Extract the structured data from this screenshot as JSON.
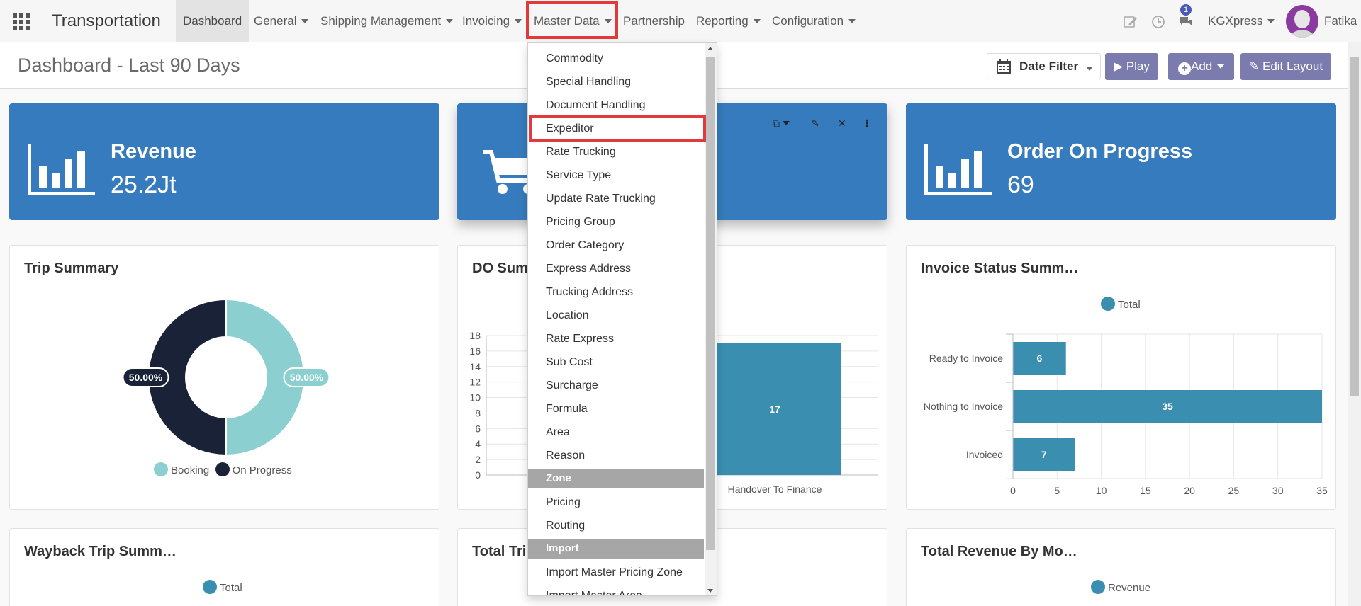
{
  "navbar": {
    "brand": "Transportation",
    "menus": [
      {
        "label": "Dashboard",
        "dropdown": false
      },
      {
        "label": "General",
        "dropdown": true
      },
      {
        "label": "Shipping Management",
        "dropdown": true
      },
      {
        "label": "Invoicing",
        "dropdown": true
      },
      {
        "label": "Master Data",
        "dropdown": true
      },
      {
        "label": "Partnership",
        "dropdown": false
      },
      {
        "label": "Reporting",
        "dropdown": true
      },
      {
        "label": "Configuration",
        "dropdown": true
      }
    ],
    "message_count": "1",
    "company": "KGXpress",
    "user": "Fatika"
  },
  "control": {
    "title": "Dashboard - Last 90 Days",
    "date_filter": "Date Filter",
    "play": "Play",
    "add": "Add",
    "edit_layout": "Edit Layout"
  },
  "kpis": [
    {
      "title": "Revenue",
      "value": "25.2Jt"
    },
    {
      "title": "",
      "value": ""
    },
    {
      "title": "Order On Progress",
      "value": "69"
    }
  ],
  "panels": {
    "trip_summary": "Trip Summary",
    "do_summary": "DO Sum",
    "invoice_status": "Invoice Status Summ…",
    "wayback": "Wayback Trip Summ…",
    "total_trip": "Total Trip",
    "total_revenue": "Total Revenue By Mo…"
  },
  "legends": {
    "invoice": "Total",
    "wayback": "Total",
    "revenue": "Revenue"
  },
  "colors": {
    "kpi": "#367bbd",
    "teal": "#3a8fb1",
    "booking": "#8ccfd0",
    "on_progress": "#1a2238",
    "highlight": "#e03a3a",
    "purple_button": "#7c7bad"
  },
  "chart_data": [
    {
      "type": "pie",
      "title": "Trip Summary",
      "categories": [
        "Booking",
        "On Progress"
      ],
      "values": [
        50.0,
        50.0
      ],
      "labels": [
        "50.00%",
        "50.00%"
      ],
      "donut": true,
      "legend": "bottom"
    },
    {
      "type": "bar",
      "title": "DO Sum",
      "categories": [
        "Handover To Finance"
      ],
      "values": [
        17
      ],
      "data_labels": [
        "17"
      ],
      "yticks": [
        "0",
        "2",
        "4",
        "6",
        "8",
        "10",
        "12",
        "14",
        "16",
        "18"
      ],
      "ylim": [
        0,
        18
      ],
      "grid": true
    },
    {
      "type": "bar",
      "orientation": "horizontal",
      "title": "Invoice Status Summ…",
      "categories": [
        "Ready to Invoice",
        "Nothing to Invoice",
        "Invoiced"
      ],
      "series": [
        {
          "name": "Total",
          "values": [
            6,
            35,
            7
          ]
        }
      ],
      "data_labels": [
        "6",
        "35",
        "7"
      ],
      "xticks": [
        "0",
        "5",
        "10",
        "15",
        "20",
        "25",
        "30",
        "35"
      ],
      "xlim": [
        0,
        35
      ],
      "legend": "top",
      "grid": true
    }
  ],
  "master_data_menu": {
    "items": [
      {
        "kind": "item",
        "label": "Commodity"
      },
      {
        "kind": "item",
        "label": "Special Handling"
      },
      {
        "kind": "item",
        "label": "Document Handling"
      },
      {
        "kind": "item",
        "label": "Expeditor",
        "highlighted": true
      },
      {
        "kind": "item",
        "label": "Rate Trucking"
      },
      {
        "kind": "item",
        "label": "Service Type"
      },
      {
        "kind": "item",
        "label": "Update Rate Trucking"
      },
      {
        "kind": "item",
        "label": "Pricing Group"
      },
      {
        "kind": "item",
        "label": "Order Category"
      },
      {
        "kind": "item",
        "label": "Express Address"
      },
      {
        "kind": "item",
        "label": "Trucking Address"
      },
      {
        "kind": "item",
        "label": "Location"
      },
      {
        "kind": "item",
        "label": "Rate Express"
      },
      {
        "kind": "item",
        "label": "Sub Cost"
      },
      {
        "kind": "item",
        "label": "Surcharge"
      },
      {
        "kind": "item",
        "label": "Formula"
      },
      {
        "kind": "item",
        "label": "Area"
      },
      {
        "kind": "item",
        "label": "Reason"
      },
      {
        "kind": "header",
        "label": "Zone"
      },
      {
        "kind": "item",
        "label": "Pricing"
      },
      {
        "kind": "item",
        "label": "Routing"
      },
      {
        "kind": "header",
        "label": "Import"
      },
      {
        "kind": "item",
        "label": "Import Master Pricing Zone"
      },
      {
        "kind": "item",
        "label": "Import Master Area"
      }
    ]
  }
}
